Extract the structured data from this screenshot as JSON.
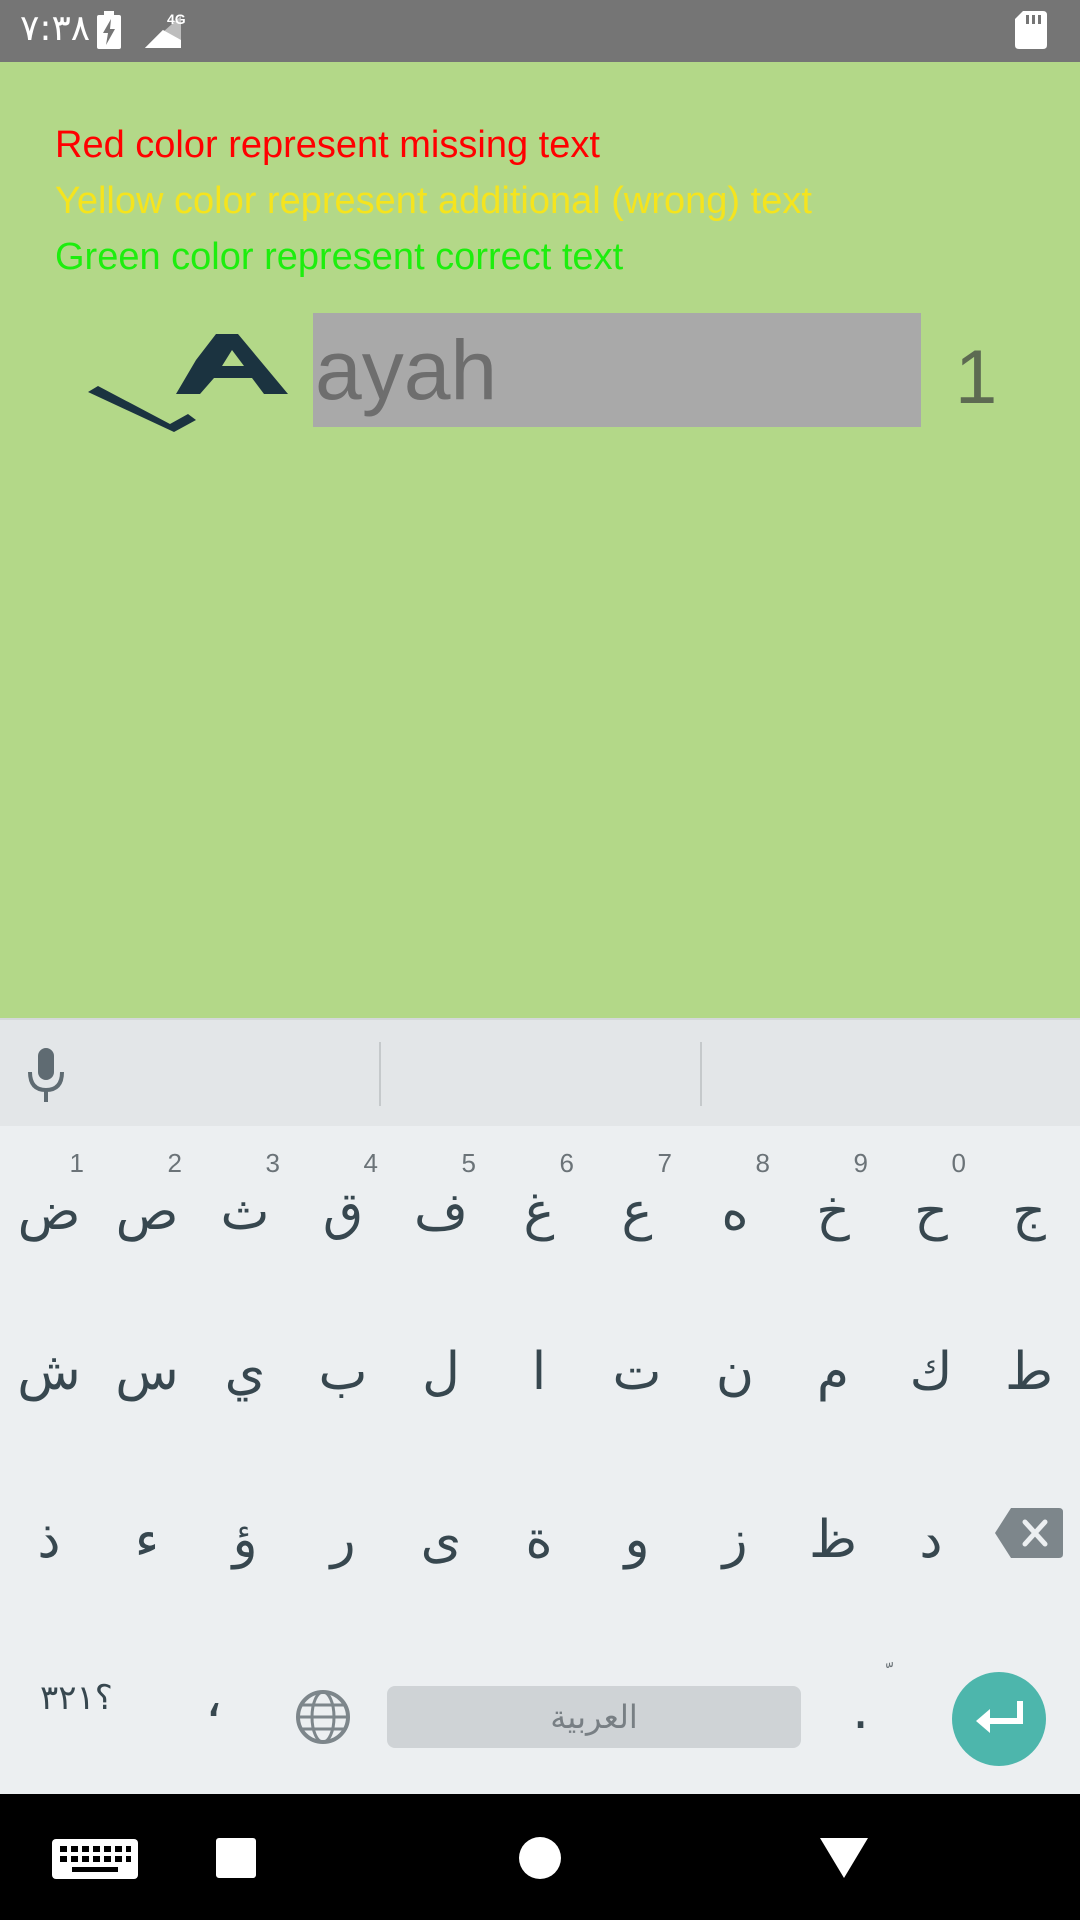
{
  "status_bar": {
    "time": "٧:٣٨",
    "network": "4G",
    "icons": [
      "battery-charging-icon",
      "signal-icon",
      "sd-card-icon"
    ]
  },
  "legend": {
    "red": "Red color represent missing text",
    "yellow": "Yellow color represent additional (wrong) text",
    "green": "Green color represent correct text",
    "colors": {
      "red": "#ff0000",
      "yellow": "#f5e41e",
      "green": "#1dee0e"
    }
  },
  "ayah": {
    "placeholder": "ayah",
    "number": "1",
    "logo_icon": "arabic-alif-logo-icon"
  },
  "keyboard": {
    "row1": [
      {
        "char": "ض",
        "hint": "1"
      },
      {
        "char": "ص",
        "hint": "2"
      },
      {
        "char": "ث",
        "hint": "3"
      },
      {
        "char": "ق",
        "hint": "4"
      },
      {
        "char": "ف",
        "hint": "5"
      },
      {
        "char": "غ",
        "hint": "6"
      },
      {
        "char": "ع",
        "hint": "7"
      },
      {
        "char": "ه",
        "hint": "8"
      },
      {
        "char": "خ",
        "hint": "9"
      },
      {
        "char": "ح",
        "hint": "0"
      },
      {
        "char": "ج",
        "hint": ""
      }
    ],
    "row2": [
      "ش",
      "س",
      "ي",
      "ب",
      "ل",
      "ا",
      "ت",
      "ن",
      "م",
      "ك",
      "ط"
    ],
    "row3": [
      "ذ",
      "ء",
      "ؤ",
      "ر",
      "ى",
      "ة",
      "و",
      "ز",
      "ظ",
      "د"
    ],
    "symbols_label": "؟٣٢١",
    "comma_label": "،",
    "space_label": "العربية",
    "period_label": ".",
    "period_hint": "ّ",
    "accent_color": "#4db6ac"
  },
  "nav_bar": {
    "icons": [
      "keyboard-icon",
      "recents-icon",
      "home-icon",
      "back-icon"
    ]
  }
}
